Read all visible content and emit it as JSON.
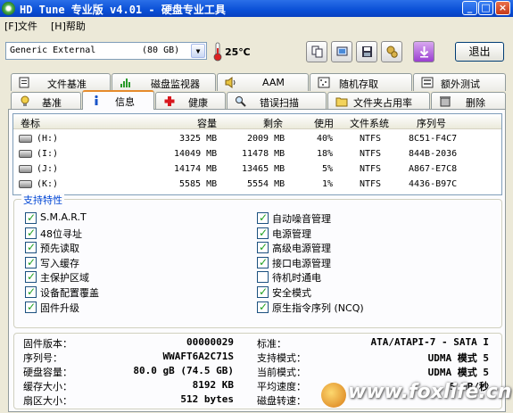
{
  "window": {
    "title": "HD Tune 专业版 v4.01 - 硬盘专业工具"
  },
  "menu": [
    {
      "label": "[F]文件"
    },
    {
      "label": "[H]帮助"
    }
  ],
  "toolbar": {
    "drive_name": "Generic External",
    "drive_size": "(80 GB)",
    "temperature": "25℃",
    "exit_label": "退出"
  },
  "tabs_top": [
    {
      "label": "文件基准",
      "icon": "file-benchmark-icon"
    },
    {
      "label": "磁盘监视器",
      "icon": "disk-monitor-icon"
    },
    {
      "label": "AAM",
      "icon": "speaker-icon"
    },
    {
      "label": "随机存取",
      "icon": "random-access-icon"
    },
    {
      "label": "额外测试",
      "icon": "extra-tests-icon"
    }
  ],
  "tabs_bottom": [
    {
      "label": "基准",
      "icon": "benchmark-icon"
    },
    {
      "label": "信息",
      "icon": "info-icon",
      "active": true
    },
    {
      "label": "健康",
      "icon": "health-cross-icon"
    },
    {
      "label": "错误扫描",
      "icon": "error-scan-icon"
    },
    {
      "label": "文件夹占用率",
      "icon": "folder-icon"
    },
    {
      "label": "删除",
      "icon": "erase-icon"
    }
  ],
  "volumes": {
    "columns": [
      "卷标",
      "容量",
      "剩余",
      "使用",
      "文件系统",
      "序列号"
    ],
    "rows": [
      [
        "(H:)",
        "3325 MB",
        "2009 MB",
        "40%",
        "NTFS",
        "8C51-F4C7"
      ],
      [
        "(I:)",
        "14049 MB",
        "11478 MB",
        "18%",
        "NTFS",
        "844B-2036"
      ],
      [
        "(J:)",
        "14174 MB",
        "13465 MB",
        "5%",
        "NTFS",
        "A867-E7C8"
      ],
      [
        "(K:)",
        "5585 MB",
        "5554 MB",
        "1%",
        "NTFS",
        "4436-B97C"
      ]
    ]
  },
  "features": {
    "title": "支持特性",
    "left": [
      {
        "label": "S.M.A.R.T",
        "checked": true
      },
      {
        "label": "48位寻址",
        "checked": true
      },
      {
        "label": "预先读取",
        "checked": true
      },
      {
        "label": "写入缓存",
        "checked": true
      },
      {
        "label": "主保护区域",
        "checked": true
      },
      {
        "label": "设备配置覆盖",
        "checked": true
      },
      {
        "label": "固件升级",
        "checked": true
      }
    ],
    "right": [
      {
        "label": "自动噪音管理",
        "checked": true
      },
      {
        "label": "电源管理",
        "checked": true
      },
      {
        "label": "高级电源管理",
        "checked": true
      },
      {
        "label": "接口电源管理",
        "checked": true
      },
      {
        "label": "待机时通电",
        "checked": false
      },
      {
        "label": "安全模式",
        "checked": true
      },
      {
        "label": "原生指令序列 (NCQ)",
        "checked": true
      }
    ]
  },
  "details": {
    "left": [
      {
        "label": "固件版本：",
        "value": "00000029"
      },
      {
        "label": "序列号：",
        "value": "WWAFT6A2C71S"
      },
      {
        "label": "硬盘容量：",
        "value": "80.0 gB (74.5 GB)"
      },
      {
        "label": "缓存大小：",
        "value": "8192 KB"
      },
      {
        "label": "扇区大小：",
        "value": "512 bytes"
      }
    ],
    "right": [
      {
        "label": "标准：",
        "value": "ATA/ATAPI-7 - SATA I"
      },
      {
        "label": "支持模式：",
        "value": "UDMA 模式 5"
      },
      {
        "label": "当前模式：",
        "value": "UDMA 模式 5"
      },
      {
        "label": "平均速度：",
        "value": "5 MB/秒"
      },
      {
        "label": "磁盘转速：",
        "value": ""
      }
    ]
  },
  "watermark": {
    "text": "www.foxlife.cn"
  }
}
